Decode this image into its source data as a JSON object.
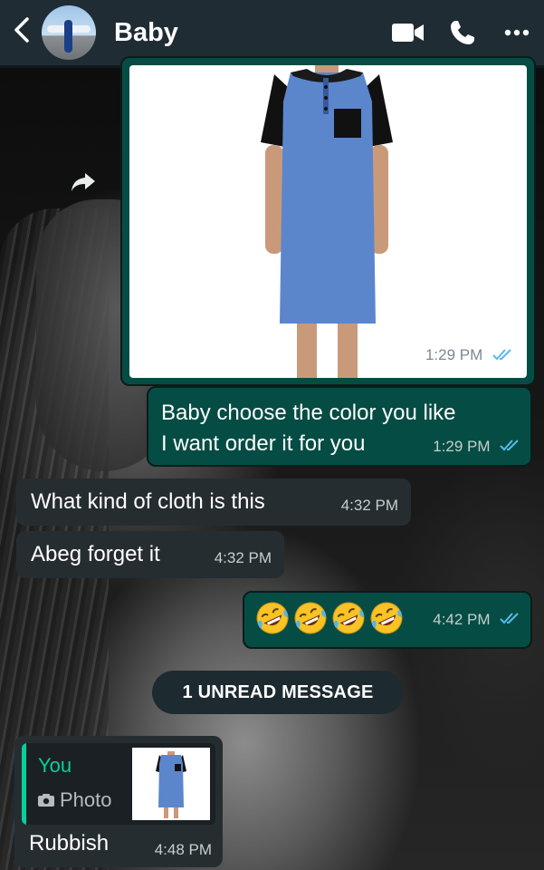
{
  "header": {
    "back_icon": "back-chevron-icon",
    "contact_name": "Baby",
    "icons": [
      "video-call-icon",
      "voice-call-icon",
      "more-options-icon"
    ]
  },
  "messages": {
    "photo": {
      "time": "1:29 PM",
      "status": "read"
    },
    "m1": {
      "line1": "Baby choose the color you like",
      "line2": "I want order it for you",
      "time": "1:29 PM",
      "status": "read"
    },
    "m2": {
      "text": "What kind of cloth is this",
      "time": "4:32 PM"
    },
    "m3": {
      "text": "Abeg forget it",
      "time": "4:32 PM"
    },
    "m4": {
      "emoji_count": 4,
      "emoji_name": "rolling-on-the-floor-laughing",
      "time": "4:42 PM",
      "status": "read"
    },
    "reply": {
      "quote_author": "You",
      "quote_type": "Photo",
      "text": "Rubbish",
      "time": "4:48 PM"
    }
  },
  "unread_divider": "1 UNREAD MESSAGE",
  "colors": {
    "header_bg": "#1f2c34",
    "outgoing_bubble": "#054d44",
    "incoming_bubble": "#262d31",
    "read_tick": "#53bdeb",
    "quote_accent": "#06cf9c",
    "dress_blue": "#5b86cc"
  }
}
